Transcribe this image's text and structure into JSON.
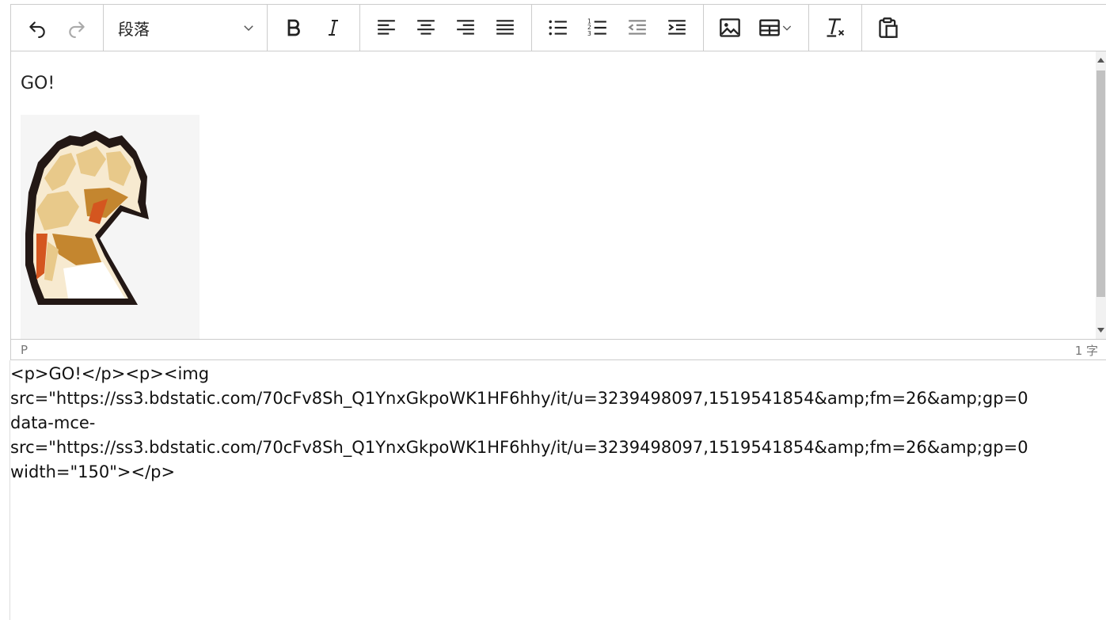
{
  "toolbar": {
    "format_select": "段落",
    "buttons": [
      "undo",
      "redo",
      "bold",
      "italic",
      "align-left",
      "align-center",
      "align-right",
      "align-justify",
      "bullet-list",
      "numbered-list",
      "outdent",
      "indent",
      "image",
      "table",
      "clear-formatting",
      "paste"
    ]
  },
  "editor": {
    "content_text": "GO!",
    "status_path": "P",
    "word_count": "1 字"
  },
  "source": {
    "lines": [
      "<p>GO!</p><p><img",
      "src=\"https://ss3.bdstatic.com/70cFv8Sh_Q1YnxGkpoWK1HF6hhy/it/u=3239498097,1519541854&amp;fm=26&amp;gp=0",
      "data-mce-",
      "src=\"https://ss3.bdstatic.com/70cFv8Sh_Q1YnxGkpoWK1HF6hhy/it/u=3239498097,1519541854&amp;fm=26&amp;gp=0",
      "width=\"150\"></p>"
    ]
  },
  "colors": {
    "border": "#cccccc",
    "fist_dark": "#231815",
    "fist_light": "#e8c98a",
    "fist_shadow": "#c4862f",
    "fist_accent": "#d4561f"
  }
}
